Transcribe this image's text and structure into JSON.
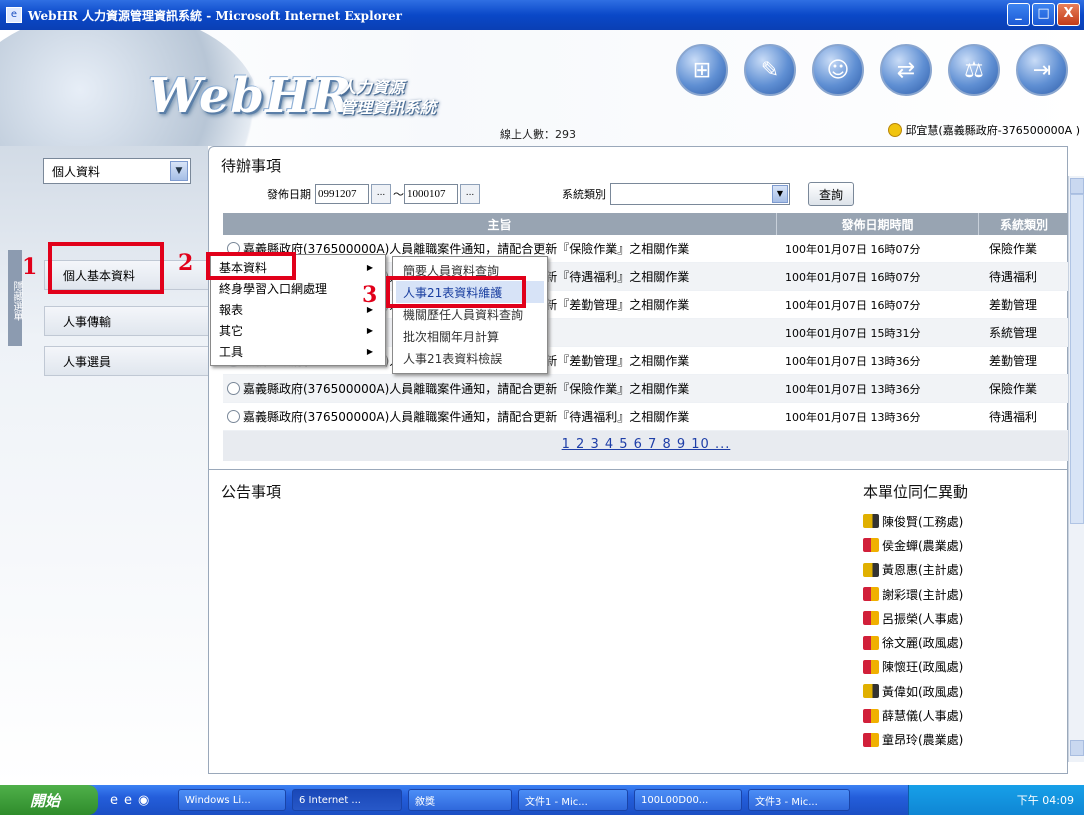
{
  "window": {
    "title": "WebHR 人力資源管理資訊系統 - Microsoft Internet Explorer",
    "min": "_",
    "max": "□",
    "close": "X"
  },
  "header": {
    "logo": "WebHR",
    "logo_sub1": "人力資源",
    "logo_sub2": "管理資訊系統",
    "online": "線上人數：293",
    "user": "邱宜慧(嘉義縣政府-376500000A )",
    "icons": [
      "org-chart-icon",
      "tools-icon",
      "person-icon",
      "exchange-icon",
      "scales-icon",
      "exit-icon"
    ]
  },
  "sidebar": {
    "select": "個人資料",
    "hide_label": "隱藏選單",
    "items": [
      "個人基本資料",
      "人事傳輸",
      "人事選員"
    ]
  },
  "annotations": {
    "n1": "1",
    "n2": "2",
    "n3": "3"
  },
  "pending": {
    "title": "待辦事項",
    "date_label": "發佈日期",
    "date_from": "0991207",
    "date_to": "1000107",
    "tilde": "～",
    "dots": "...",
    "sys_label": "系統類別",
    "query": "查詢",
    "columns": [
      "主旨",
      "發佈日期時間",
      "系統類別"
    ],
    "rows": [
      {
        "subject": "嘉義縣政府(376500000A)人員離職案件通知，請配合更新『保險作業』之相關作業",
        "date": "100年01月07日 16時07分",
        "type": "保險作業"
      },
      {
        "subject": "嘉義縣政府(376500000A)人員離職案件通知，請配合更新『待遇福利』之相關作業",
        "date": "100年01月07日 16時07分",
        "type": "待遇福利"
      },
      {
        "subject": "嘉義縣政府(376500000A)人員離職案件通知，請配合更新『差勤管理』之相關作業",
        "date": "100年01月07日 16時07分",
        "type": "差勤管理"
      },
      {
        "subject": "",
        "date": "100年01月07日 15時31分",
        "type": "系統管理"
      },
      {
        "subject": "嘉義縣政府(376500000A)人員離職案件通知，請配合更新『差勤管理』之相關作業",
        "date": "100年01月07日 13時36分",
        "type": "差勤管理"
      },
      {
        "subject": "嘉義縣政府(376500000A)人員離職案件通知，請配合更新『保險作業』之相關作業",
        "date": "100年01月07日 13時36分",
        "type": "保險作業"
      },
      {
        "subject": "嘉義縣政府(376500000A)人員離職案件通知，請配合更新『待遇福利』之相關作業",
        "date": "100年01月07日 13時36分",
        "type": "待遇福利"
      }
    ],
    "pager": "1 2 3 4 5 6 7 8 9 10 ..."
  },
  "menu": {
    "main": [
      "基本資料",
      "終身學習入口網處理",
      "報表",
      "其它",
      "工具"
    ],
    "sub": [
      "簡要人員資料查詢",
      "人事21表資料維護",
      "機關歷任人員資料查詢",
      "批次相關年月計算",
      "人事21表資料檢誤"
    ],
    "arrow": "▶"
  },
  "announce": {
    "title": "公告事項"
  },
  "staff": {
    "title": "本單位同仁異動",
    "items": [
      {
        "name": "陳俊賢(工務處)",
        "g": "m"
      },
      {
        "name": "侯金蟬(農業處)",
        "g": "f"
      },
      {
        "name": "黃恩惠(主計處)",
        "g": "m"
      },
      {
        "name": "謝彩環(主計處)",
        "g": "f"
      },
      {
        "name": "呂振榮(人事處)",
        "g": "f"
      },
      {
        "name": "徐文麗(政風處)",
        "g": "f"
      },
      {
        "name": "陳懷玨(政風處)",
        "g": "f"
      },
      {
        "name": "黃偉如(政風處)",
        "g": "m"
      },
      {
        "name": "薛慧儀(人事處)",
        "g": "f"
      },
      {
        "name": "童昂玲(農業處)",
        "g": "f"
      }
    ]
  },
  "taskbar": {
    "start": "開始",
    "tasks": [
      "Windows Li...",
      "6 Internet ...",
      "敘獎",
      "文件1 - Mic...",
      "100L00D00...",
      "文件3 - Mic..."
    ],
    "clock": "下午 04:09"
  }
}
